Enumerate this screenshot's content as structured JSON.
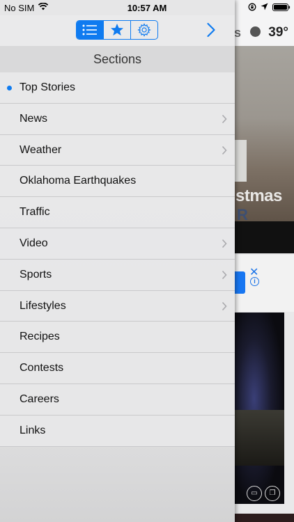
{
  "status_bar": {
    "carrier": "No SIM",
    "time": "10:57 AM"
  },
  "background": {
    "temperature": "39°",
    "partial_header_text": "s",
    "hero_text_line1": "stmas",
    "hero_text_line2": "R"
  },
  "toolbar": {
    "segments": [
      {
        "icon": "list-icon",
        "active": true
      },
      {
        "icon": "star-icon",
        "active": false
      },
      {
        "icon": "gear-icon",
        "active": false
      }
    ],
    "forward_icon": "chevron-right-icon"
  },
  "sections": {
    "title": "Sections",
    "items": [
      {
        "label": "Top Stories",
        "selected": true,
        "has_children": false
      },
      {
        "label": "News",
        "selected": false,
        "has_children": true
      },
      {
        "label": "Weather",
        "selected": false,
        "has_children": true
      },
      {
        "label": "Oklahoma Earthquakes",
        "selected": false,
        "has_children": false
      },
      {
        "label": "Traffic",
        "selected": false,
        "has_children": false
      },
      {
        "label": "Video",
        "selected": false,
        "has_children": true
      },
      {
        "label": "Sports",
        "selected": false,
        "has_children": true
      },
      {
        "label": "Lifestyles",
        "selected": false,
        "has_children": true
      },
      {
        "label": "Recipes",
        "selected": false,
        "has_children": false
      },
      {
        "label": "Contests",
        "selected": false,
        "has_children": false
      },
      {
        "label": "Careers",
        "selected": false,
        "has_children": false
      },
      {
        "label": "Links",
        "selected": false,
        "has_children": false
      }
    ]
  },
  "colors": {
    "accent": "#0f7bf0",
    "selected_dot": "#0f7bf0"
  }
}
